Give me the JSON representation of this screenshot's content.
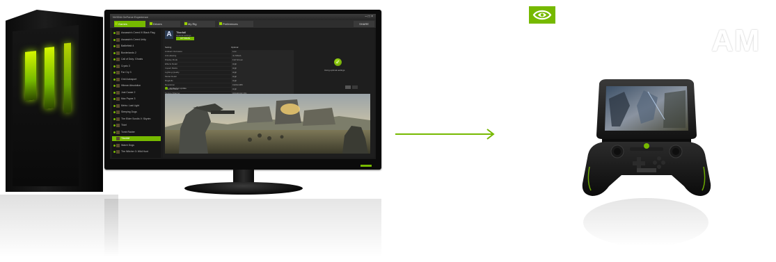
{
  "brand": {
    "logo": "nvidia-eye-logo",
    "accent_color": "#76b900",
    "partial_heading": "AM"
  },
  "app": {
    "window_title": "NVIDIA GeForce Experience",
    "window_controls": "– □ ×",
    "tabs": [
      {
        "label": "Games",
        "active": true
      },
      {
        "label": "Drivers",
        "active": false
      },
      {
        "label": "My Rig",
        "active": false
      },
      {
        "label": "Preferences",
        "active": false
      }
    ],
    "share_label": "SHARE",
    "games": [
      "Assassin's Creed IV Black Flag",
      "Assassin's Creed Unity",
      "Battlefield 4",
      "Borderlands 2",
      "Call of Duty: Ghosts",
      "Crysis 3",
      "Far Cry 3",
      "Grid Autosport",
      "Hitman Absolution",
      "Just Cause 2",
      "Max Payne 3",
      "Metro: Last Light",
      "Sleeping Dogs",
      "The Elder Scrolls V: Skyrim",
      "Thief",
      "Tomb Raider",
      "Titanfall",
      "Watch Dogs",
      "The Witcher 3: Wild Hunt"
    ],
    "selected_game_index": 16,
    "detail": {
      "logo_glyph": "A",
      "title": "Titanfall",
      "status": "Optimal settings",
      "optimize_label": "OPTIMIZE",
      "col_setting": "Setting",
      "col_value": "Optimal",
      "settings": [
        {
          "name": "Ambient Occlusion",
          "value": "Low"
        },
        {
          "name": "Anti-aliasing",
          "value": "4x MSAA"
        },
        {
          "name": "Display Mode",
          "value": "Full Screen"
        },
        {
          "name": "Effects Detail",
          "value": "High"
        },
        {
          "name": "Impact Marks",
          "value": "High"
        },
        {
          "name": "Lighting Quality",
          "value": "High"
        },
        {
          "name": "Model Detail",
          "value": "High"
        },
        {
          "name": "Ragdolls",
          "value": "High"
        },
        {
          "name": "Resolution",
          "value": "1920x1080"
        },
        {
          "name": "Shadow Detail",
          "value": "High"
        },
        {
          "name": "Texture Filtering",
          "value": "Anisotropic 16x"
        },
        {
          "name": "Texture Resolution",
          "value": "Insane"
        }
      ],
      "optimal_caption": "Using optimal settings",
      "applied_note": "Applied on update"
    }
  },
  "devices": {
    "pc": "gaming-pc-tower",
    "monitor": "pc-monitor",
    "handheld": "nvidia-shield-portable",
    "stream_arrow": "green-arrow-right"
  }
}
